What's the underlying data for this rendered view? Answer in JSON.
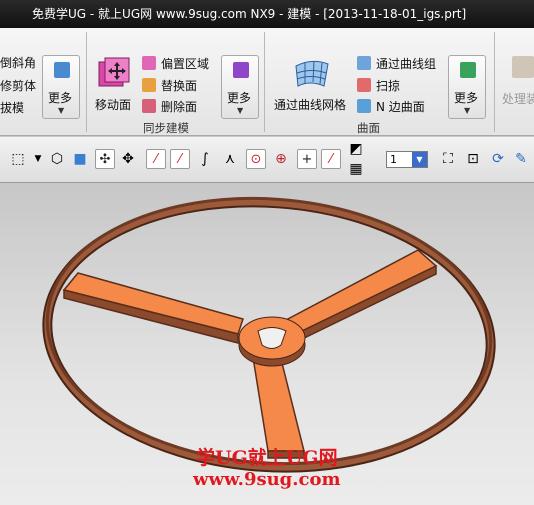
{
  "window": {
    "title": "免费学UG - 就上UG网 www.9sug.com NX9 - 建模 - [2013-11-18-01_igs.prt]"
  },
  "ribbon": {
    "left_partial": [
      "倒斜角",
      "修剪体",
      "拔模"
    ],
    "more_label": "更多",
    "sync_group": {
      "big_button": "移动面",
      "items": [
        "偏置区域",
        "替换面",
        "删除面"
      ],
      "group_label": "同步建模"
    },
    "surface_group": {
      "big_button": "通过曲线网格",
      "items": [
        "通过曲线组",
        "扫掠",
        "N 边曲面"
      ],
      "group_label": "曲面"
    },
    "right_partial": "处理装"
  },
  "toolbar": {
    "layer_value": "1"
  },
  "watermark": {
    "line1": "学UG就上UG网",
    "line2": "www.9sug.com"
  },
  "colors": {
    "part_fill": "#f5894a",
    "rim_dark": "#6e3a24",
    "rim_mid": "#8c4a2c"
  }
}
